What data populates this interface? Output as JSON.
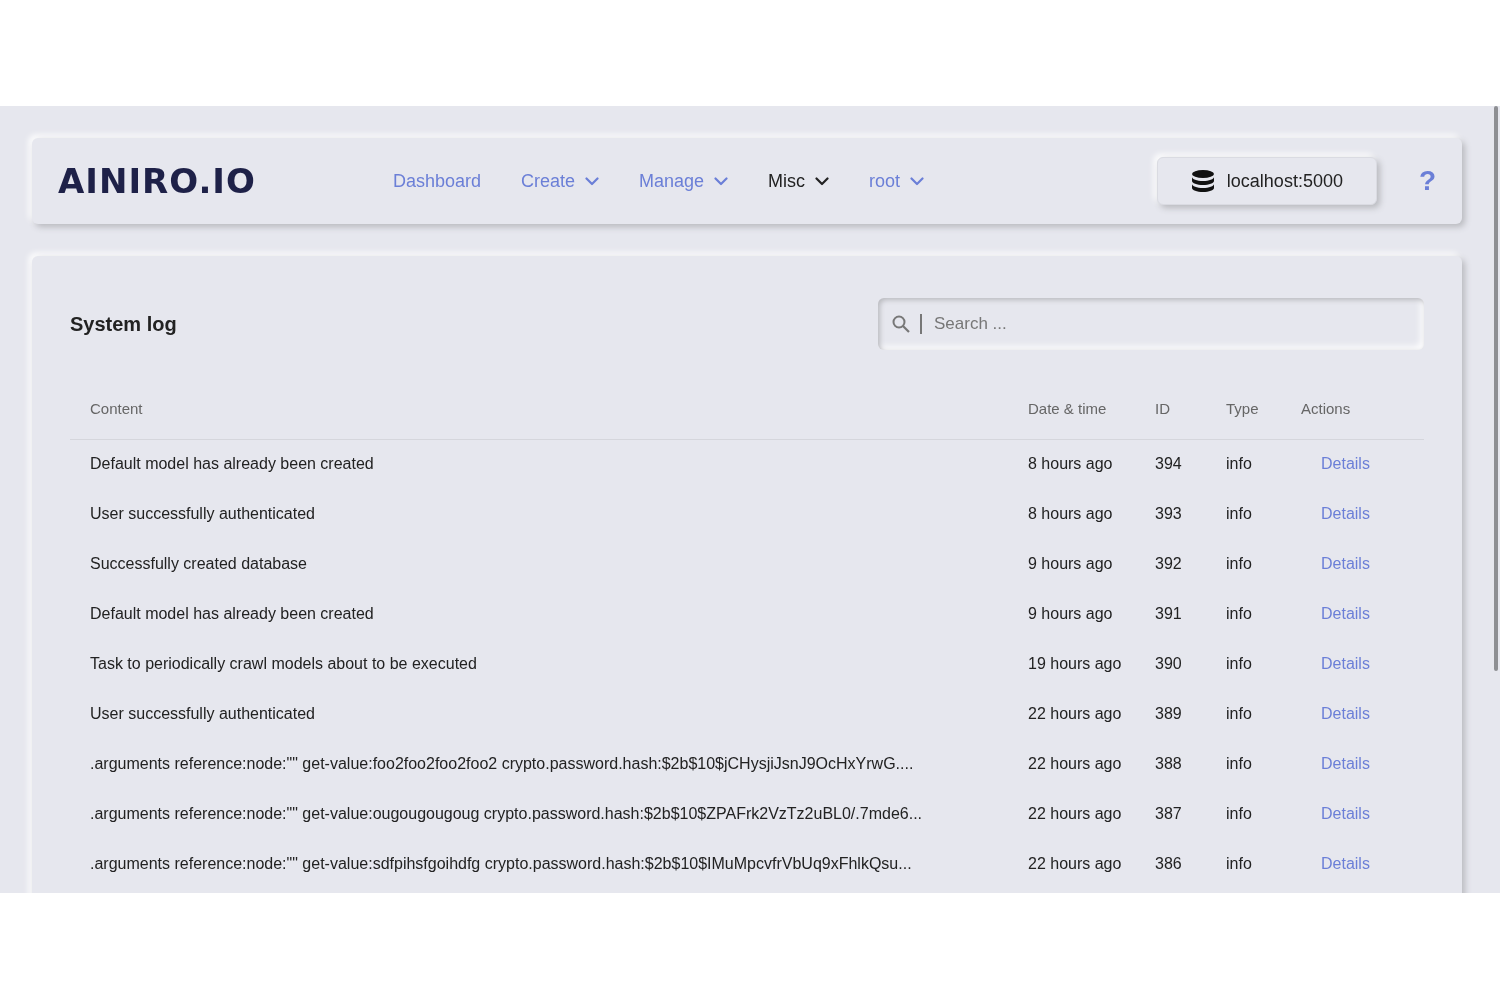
{
  "logo": "AINIRO.IO",
  "nav": [
    {
      "label": "Dashboard",
      "dropdown": false,
      "selected": false
    },
    {
      "label": "Create",
      "dropdown": true,
      "selected": false
    },
    {
      "label": "Manage",
      "dropdown": true,
      "selected": false
    },
    {
      "label": "Misc",
      "dropdown": true,
      "selected": true
    },
    {
      "label": "root",
      "dropdown": true,
      "selected": false
    }
  ],
  "server_button": "localhost:5000",
  "help": "?",
  "page_title": "System log",
  "search": {
    "placeholder": "Search ..."
  },
  "table": {
    "columns": [
      "Content",
      "Date & time",
      "ID",
      "Type",
      "Actions"
    ],
    "rows": [
      {
        "content": "Default model has already been created",
        "time": "8 hours ago",
        "id": "394",
        "type": "info",
        "action": "Details"
      },
      {
        "content": "User successfully authenticated",
        "time": "8 hours ago",
        "id": "393",
        "type": "info",
        "action": "Details"
      },
      {
        "content": "Successfully created database",
        "time": "9 hours ago",
        "id": "392",
        "type": "info",
        "action": "Details"
      },
      {
        "content": "Default model has already been created",
        "time": "9 hours ago",
        "id": "391",
        "type": "info",
        "action": "Details"
      },
      {
        "content": "Task to periodically crawl models about to be executed",
        "time": "19 hours ago",
        "id": "390",
        "type": "info",
        "action": "Details"
      },
      {
        "content": "User successfully authenticated",
        "time": "22 hours ago",
        "id": "389",
        "type": "info",
        "action": "Details"
      },
      {
        "content": ".arguments reference:node:\"\" get-value:foo2foo2foo2foo2 crypto.password.hash:$2b$10$jCHysjiJsnJ9OcHxYrwG....",
        "time": "22 hours ago",
        "id": "388",
        "type": "info",
        "action": "Details"
      },
      {
        "content": ".arguments reference:node:\"\" get-value:ougougougoug crypto.password.hash:$2b$10$ZPAFrk2VzTz2uBL0/.7mde6...",
        "time": "22 hours ago",
        "id": "387",
        "type": "info",
        "action": "Details"
      },
      {
        "content": ".arguments reference:node:\"\" get-value:sdfpihsfgoihdfg crypto.password.hash:$2b$10$IMuMpcvfrVbUq9xFhlkQsu...",
        "time": "22 hours ago",
        "id": "386",
        "type": "info",
        "action": "Details"
      }
    ]
  }
}
